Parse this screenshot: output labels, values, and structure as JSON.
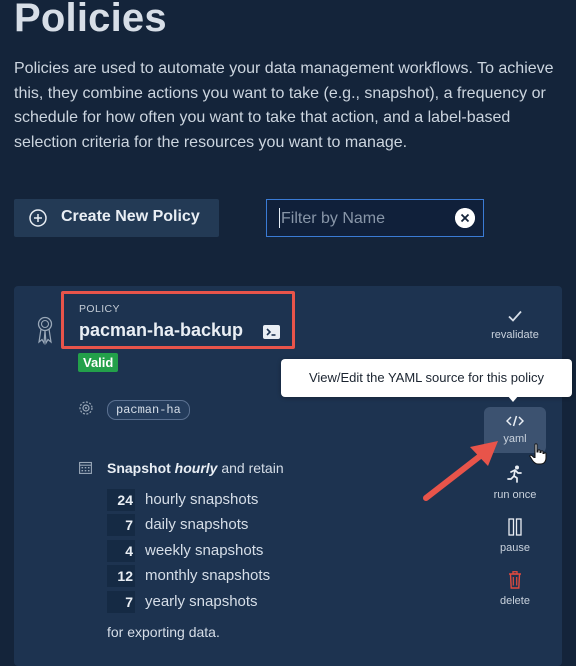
{
  "header": {
    "title": "Policies",
    "description": "Policies are used to automate your data management workflows. To achieve this, they combine actions you want to take (e.g., snapshot), a frequency or schedule for how often you want to take that action, and a label-based selection criteria for the resources you want to manage."
  },
  "toolbar": {
    "create_label": "Create New Policy",
    "filter_placeholder": "Filter by Name"
  },
  "policy": {
    "kicker": "POLICY",
    "name": "pacman-ha-backup",
    "status": "Valid",
    "selector_label": "pacman-ha",
    "schedule_prefix": "Snapshot",
    "schedule_frequency": "hourly",
    "schedule_suffix": "and retain",
    "retention": [
      {
        "count": "24",
        "label": "hourly snapshots"
      },
      {
        "count": "7",
        "label": "daily snapshots"
      },
      {
        "count": "4",
        "label": "weekly snapshots"
      },
      {
        "count": "12",
        "label": "monthly snapshots"
      },
      {
        "count": "7",
        "label": "yearly snapshots"
      }
    ],
    "export_text": "for exporting data."
  },
  "actions": {
    "revalidate": "revalidate",
    "yaml": "yaml",
    "run_once": "run once",
    "pause": "pause",
    "delete": "delete"
  },
  "tooltip": {
    "text": "View/Edit the YAML source for this policy"
  },
  "colors": {
    "background": "#14243a",
    "card": "#1d3350",
    "valid_badge": "#23a04a",
    "annotation_red": "#e8544a",
    "delete_red": "#e04a3f",
    "focus_blue": "#3a7bd5"
  },
  "icons": {
    "create": "plus-circle-icon",
    "clear": "clear-icon",
    "policy": "ribbon-icon",
    "yaml_source": "terminal-icon",
    "selector": "target-icon",
    "schedule": "calendar-icon",
    "revalidate": "check-icon",
    "yaml": "code-icon",
    "run_once": "running-person-icon",
    "pause": "pause-icon",
    "delete": "trash-icon",
    "cursor": "hand-cursor-icon"
  }
}
